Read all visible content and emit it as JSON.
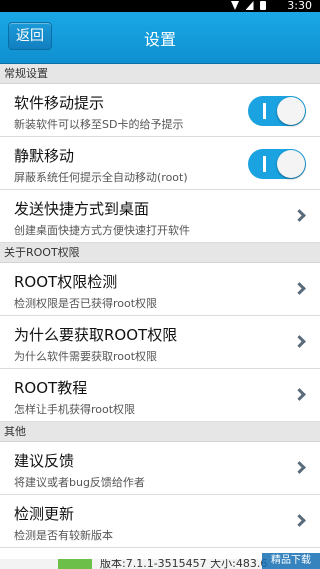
{
  "status_bar": {
    "time": "3:30"
  },
  "header": {
    "back_label": "返回",
    "title": "设置"
  },
  "sections": [
    {
      "header": "常规设置"
    },
    {
      "header": "关于ROOT权限"
    },
    {
      "header": "其他"
    }
  ],
  "rows": {
    "software_move": {
      "title": "软件移动提示",
      "subtitle": "新装软件可以移至SD卡的给予提示",
      "toggle_on": true
    },
    "silent_move": {
      "title": "静默移动",
      "subtitle": "屏蔽系统任何提示全自动移动(root)",
      "toggle_on": true
    },
    "shortcut": {
      "title": "发送快捷方式到桌面",
      "subtitle": "创建桌面快捷方式方便快速打开软件"
    },
    "root_check": {
      "title": "ROOT权限检测",
      "subtitle": "检测权限是否已获得root权限"
    },
    "why_root": {
      "title": "为什么要获取ROOT权限",
      "subtitle": "为什么软件需要获取root权限"
    },
    "root_tutorial": {
      "title": "ROOT教程",
      "subtitle": "怎样让手机获得root权限"
    },
    "feedback": {
      "title": "建议反馈",
      "subtitle": "将建议或者bug反馈给作者"
    },
    "update": {
      "title": "检测更新",
      "subtitle": "检测是否有较新版本"
    }
  },
  "bottom": {
    "version_text": "版本:7.1.1-3515457 大小:483.6"
  },
  "watermark": {
    "text": "精品下载"
  },
  "colors": {
    "titlebar": "#1aa3e0",
    "toggle_on": "#1aa3e0",
    "section_bg": "#e6e6e6"
  }
}
